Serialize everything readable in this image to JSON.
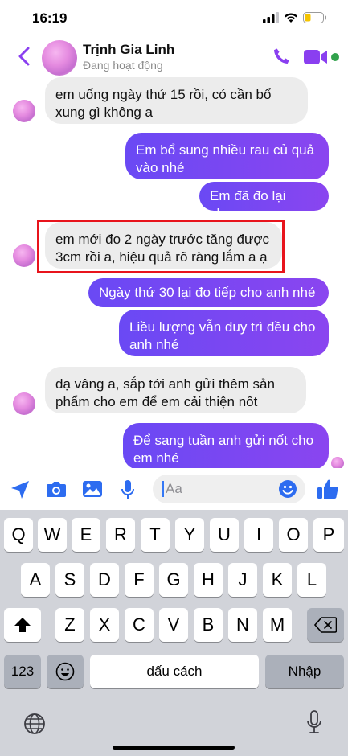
{
  "status_bar": {
    "time": "16:19"
  },
  "header": {
    "contact_name": "Trịnh Gia Linh",
    "contact_status": "Đang hoạt động",
    "accent_color": "#8a3ff0"
  },
  "messages": [
    {
      "side": "in",
      "lines": [
        "em uống ngày thứ 15 rồi, có cần bổ",
        "xung gì không a"
      ]
    },
    {
      "side": "out",
      "lines": [
        "Em bổ sung nhiều rau củ quả",
        "vào nhé"
      ]
    },
    {
      "side": "out",
      "lines": [
        "Em đã đo lại chưa"
      ]
    },
    {
      "side": "in",
      "lines": [
        "em mới đo 2 ngày trước tăng được",
        "3cm rồi a, hiệu quả rõ ràng lắm a ạ"
      ],
      "highlighted": true
    },
    {
      "side": "out",
      "lines": [
        "Ngày thứ 30 lại đo tiếp cho anh nhé"
      ]
    },
    {
      "side": "out",
      "lines": [
        "Liều lượng vẫn duy trì đều cho",
        "anh nhé"
      ]
    },
    {
      "side": "in",
      "lines": [
        "dạ vâng a, sắp tới anh gửi thêm sản",
        "phẩm cho em để em cải thiện nốt"
      ]
    },
    {
      "side": "out",
      "lines": [
        "Để sang tuần anh gửi nốt cho",
        "em nhé"
      ]
    }
  ],
  "composer": {
    "placeholder": "Aa"
  },
  "keyboard": {
    "row1": [
      "Q",
      "W",
      "E",
      "R",
      "T",
      "Y",
      "U",
      "I",
      "O",
      "P"
    ],
    "row2": [
      "A",
      "S",
      "D",
      "F",
      "G",
      "H",
      "J",
      "K",
      "L"
    ],
    "row3": [
      "Z",
      "X",
      "C",
      "V",
      "B",
      "N",
      "M"
    ],
    "numbers_key": "123",
    "space_key": "dấu cách",
    "return_key": "Nhập"
  },
  "colors": {
    "outgoing_bubble": "#7047f2",
    "incoming_bubble": "#ececec",
    "highlight_border": "#e8141c",
    "keyboard_bg": "#d1d3d9"
  }
}
